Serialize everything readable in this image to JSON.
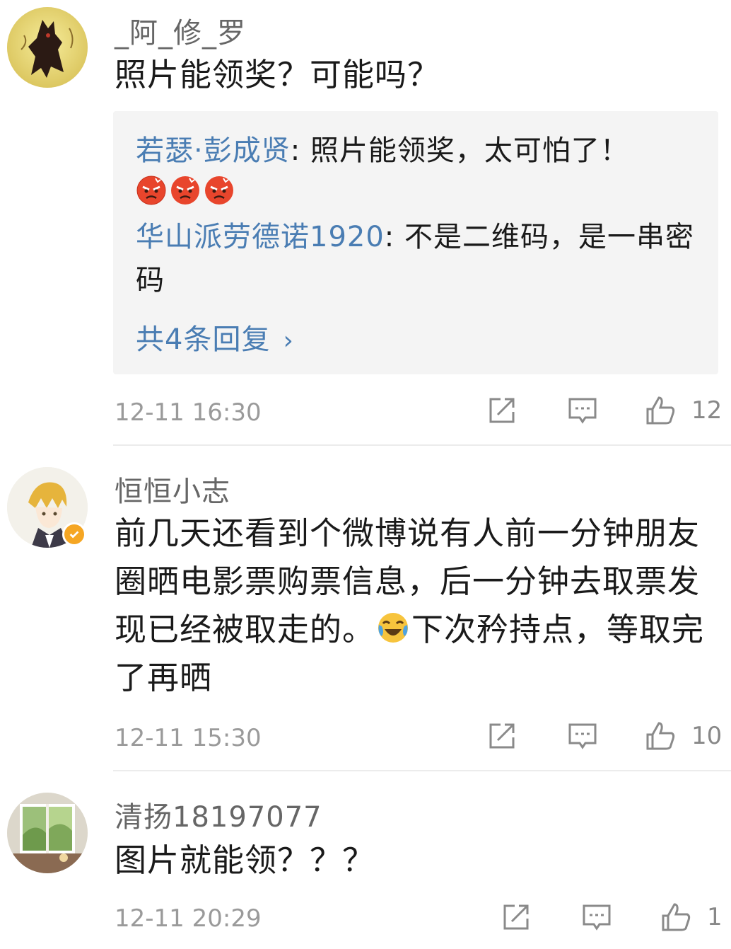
{
  "comments": [
    {
      "username": "_阿_修_罗",
      "text": "照片能领奖？可能吗？",
      "replies": [
        {
          "name": "若瑟·彭成贤",
          "text": ": 照片能领奖，太可怕了！"
        },
        {
          "name": "华山派劳德诺1920",
          "text": ": 不是二维码，是一串密码"
        }
      ],
      "reply_emojis": [
        "angry-face-emoji",
        "angry-face-emoji",
        "angry-face-emoji"
      ],
      "more_replies": "共4条回复",
      "more_chevron": "›",
      "time": "12-11 16:30",
      "likes": "12"
    },
    {
      "username": "恒恒小志",
      "text_before": "前几天还看到个微博说有人前一分钟朋友圈晒电影票购票信息，后一分钟去取票发现已经被取走的。",
      "emoji": "laugh-cry-emoji",
      "text_after": "下次矜持点，等取完了再晒",
      "verified_badge": "verified-badge-icon",
      "time": "12-11 15:30",
      "likes": "10"
    },
    {
      "username": "清扬18197077",
      "text": "图片就能领？？？",
      "time": "12-11 20:29",
      "likes": "1"
    }
  ],
  "icons": {
    "repost": "repost-icon",
    "comment": "comment-icon",
    "like": "thumbs-up-icon"
  },
  "colors": {
    "link": "#4a7db3",
    "secondary_text": "#9a9a9a",
    "reply_bg": "#f4f4f4",
    "badge": "#f5a623"
  }
}
